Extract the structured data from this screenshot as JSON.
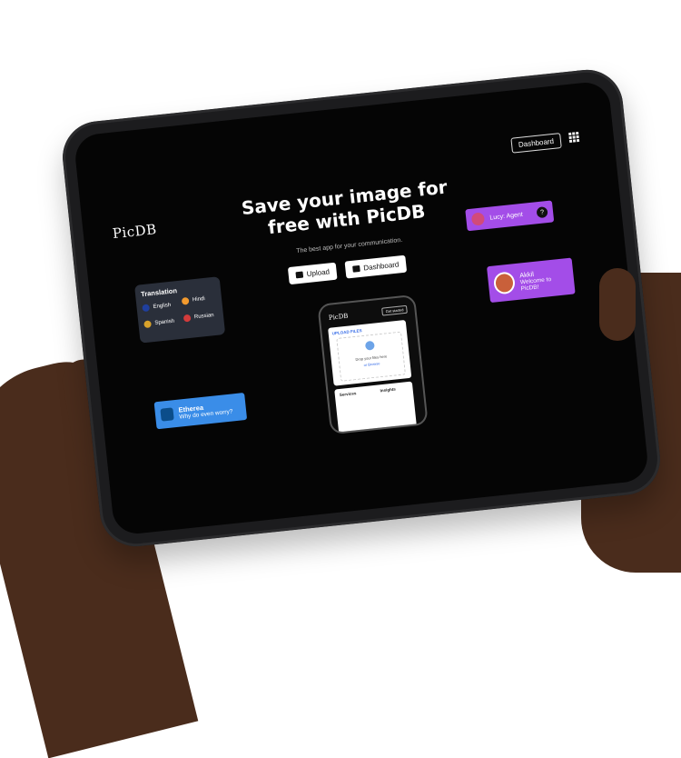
{
  "app": {
    "logo": "PicDB"
  },
  "header": {
    "dashboard_label": "Dashboard",
    "menu_icon": "grid-icon"
  },
  "hero": {
    "title_line1": "Save your image for",
    "title_line2": "free with PicDB",
    "subtitle": "The best app for your communication.",
    "upload_label": "Upload",
    "dashboard_label": "Dashboard"
  },
  "translation": {
    "title": "Translation",
    "languages": [
      {
        "label": "English",
        "flag": "uk-flag-icon"
      },
      {
        "label": "Hindi",
        "flag": "india-flag-icon"
      },
      {
        "label": "Spanish",
        "flag": "spain-flag-icon"
      },
      {
        "label": "Russian",
        "flag": "russia-flag-icon"
      }
    ]
  },
  "chats": {
    "lucy": {
      "name": "Lucy: Agent",
      "help": "?"
    },
    "akkil": {
      "name": "Akkil",
      "message": "Welcome to PicDB!"
    },
    "etherea": {
      "name": "Etherea",
      "message": "Why do even worry?"
    }
  },
  "phone": {
    "logo": "PicDB",
    "button": "Get started",
    "upload_title": "UPLOAD FILES",
    "drop_text": "Drop your files here",
    "browse_text": "or Browse",
    "col1": "Services",
    "col2": "Insights"
  },
  "colors": {
    "purple": "#a34de8",
    "blue": "#3a8de8",
    "screen": "#050505"
  }
}
